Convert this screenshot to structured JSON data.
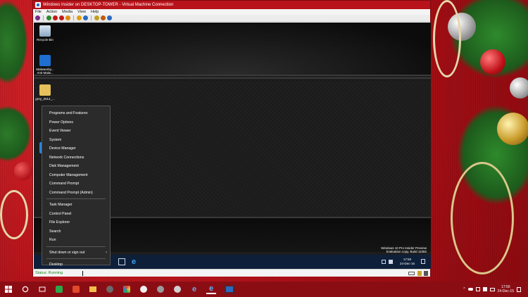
{
  "vm": {
    "title": "Windows Insider on DESKTOP-TOWER - Virtual Machine Connection",
    "menu": [
      "File",
      "Action",
      "Media",
      "View",
      "Help"
    ],
    "status_label": "Status: Running"
  },
  "guest_desktop": {
    "icons": [
      {
        "label": "Recycle Bin",
        "icon": "recycle-bin-icon"
      },
      {
        "label": "Malwareby... Anti-Malw...",
        "icon": "malwarebytes-icon"
      },
      {
        "label": "grey_2014_...",
        "icon": "folder-icon"
      }
    ],
    "watermark_line1": "Windows 10 Pro Insider Preview",
    "watermark_line2": "Evaluation copy. Build 11082",
    "clock_time": "17:50",
    "clock_date": "24-Dec-15"
  },
  "winx_menu": {
    "groups": [
      [
        "Programs and Features",
        "Power Options",
        "Event Viewer",
        "System",
        "Device Manager",
        "Network Connections",
        "Disk Management",
        "Computer Management",
        "Command Prompt",
        "Command Prompt (Admin)"
      ],
      [
        "Task Manager",
        "Control Panel",
        "File Explorer",
        "Search",
        "Run"
      ],
      [
        "Shut down or sign out",
        "Desktop"
      ]
    ],
    "submenu_arrow": "›"
  },
  "host_taskbar": {
    "clock_time": "17:50",
    "clock_date": "24-Dec-15"
  },
  "colors": {
    "accent": "#b8121a",
    "host_taskbar": "#8b0d14",
    "guest_taskbar": "#0e1f3a",
    "menu_bg": "#2b2b2b"
  }
}
